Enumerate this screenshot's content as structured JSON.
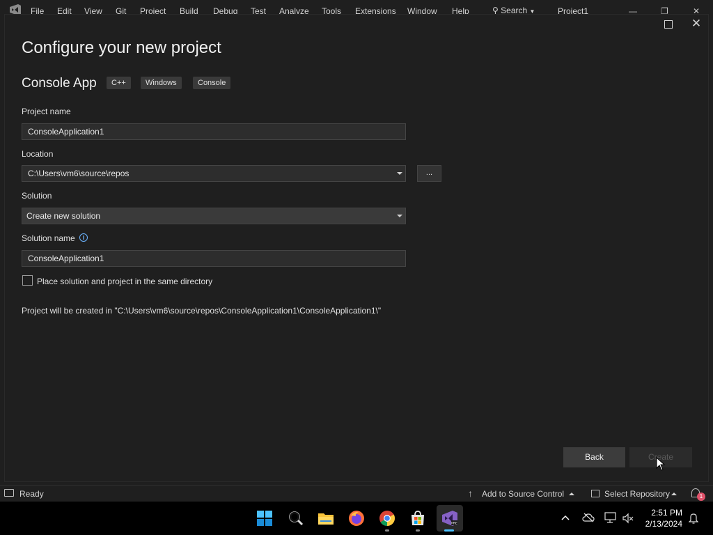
{
  "vs_window": {
    "menu": [
      "File",
      "Edit",
      "View",
      "Git",
      "Project",
      "Build",
      "Debug",
      "Test",
      "Analyze",
      "Tools",
      "Extensions",
      "Window",
      "Help"
    ],
    "search_label": "Search",
    "title": "Project1"
  },
  "dialog": {
    "title": "Configure your new project",
    "template_name": "Console App",
    "tags": [
      "C++",
      "Windows",
      "Console"
    ],
    "project_name_label": "Project name",
    "project_name_value": "ConsoleApplication1",
    "location_label": "Location",
    "location_value": "C:\\Users\\vm6\\source\\repos",
    "browse_label": "...",
    "solution_label": "Solution",
    "solution_value": "Create new solution",
    "solution_name_label": "Solution name",
    "solution_name_value": "ConsoleApplication1",
    "same_dir_label": "Place solution and project in the same directory",
    "same_dir_checked": false,
    "path_note": "Project will be created in \"C:\\Users\\vm6\\source\\repos\\ConsoleApplication1\\ConsoleApplication1\\\"",
    "back_label": "Back",
    "create_label": "Create"
  },
  "statusbar": {
    "status": "Ready",
    "source_control": "Add to Source Control",
    "repository": "Select Repository",
    "notification_count": "1"
  },
  "taskbar": {
    "apps": [
      "start-icon",
      "search-icon",
      "file-explorer-icon",
      "firefox-icon",
      "chrome-icon",
      "store-icon",
      "visual-studio-icon"
    ],
    "time": "2:51 PM",
    "date": "2/13/2024"
  },
  "colors": {
    "background": "#1f1f1f",
    "field": "#2d2d2d",
    "button": "#3c3c3c",
    "accent": "#6cb4ff",
    "badge": "#e0526a"
  }
}
